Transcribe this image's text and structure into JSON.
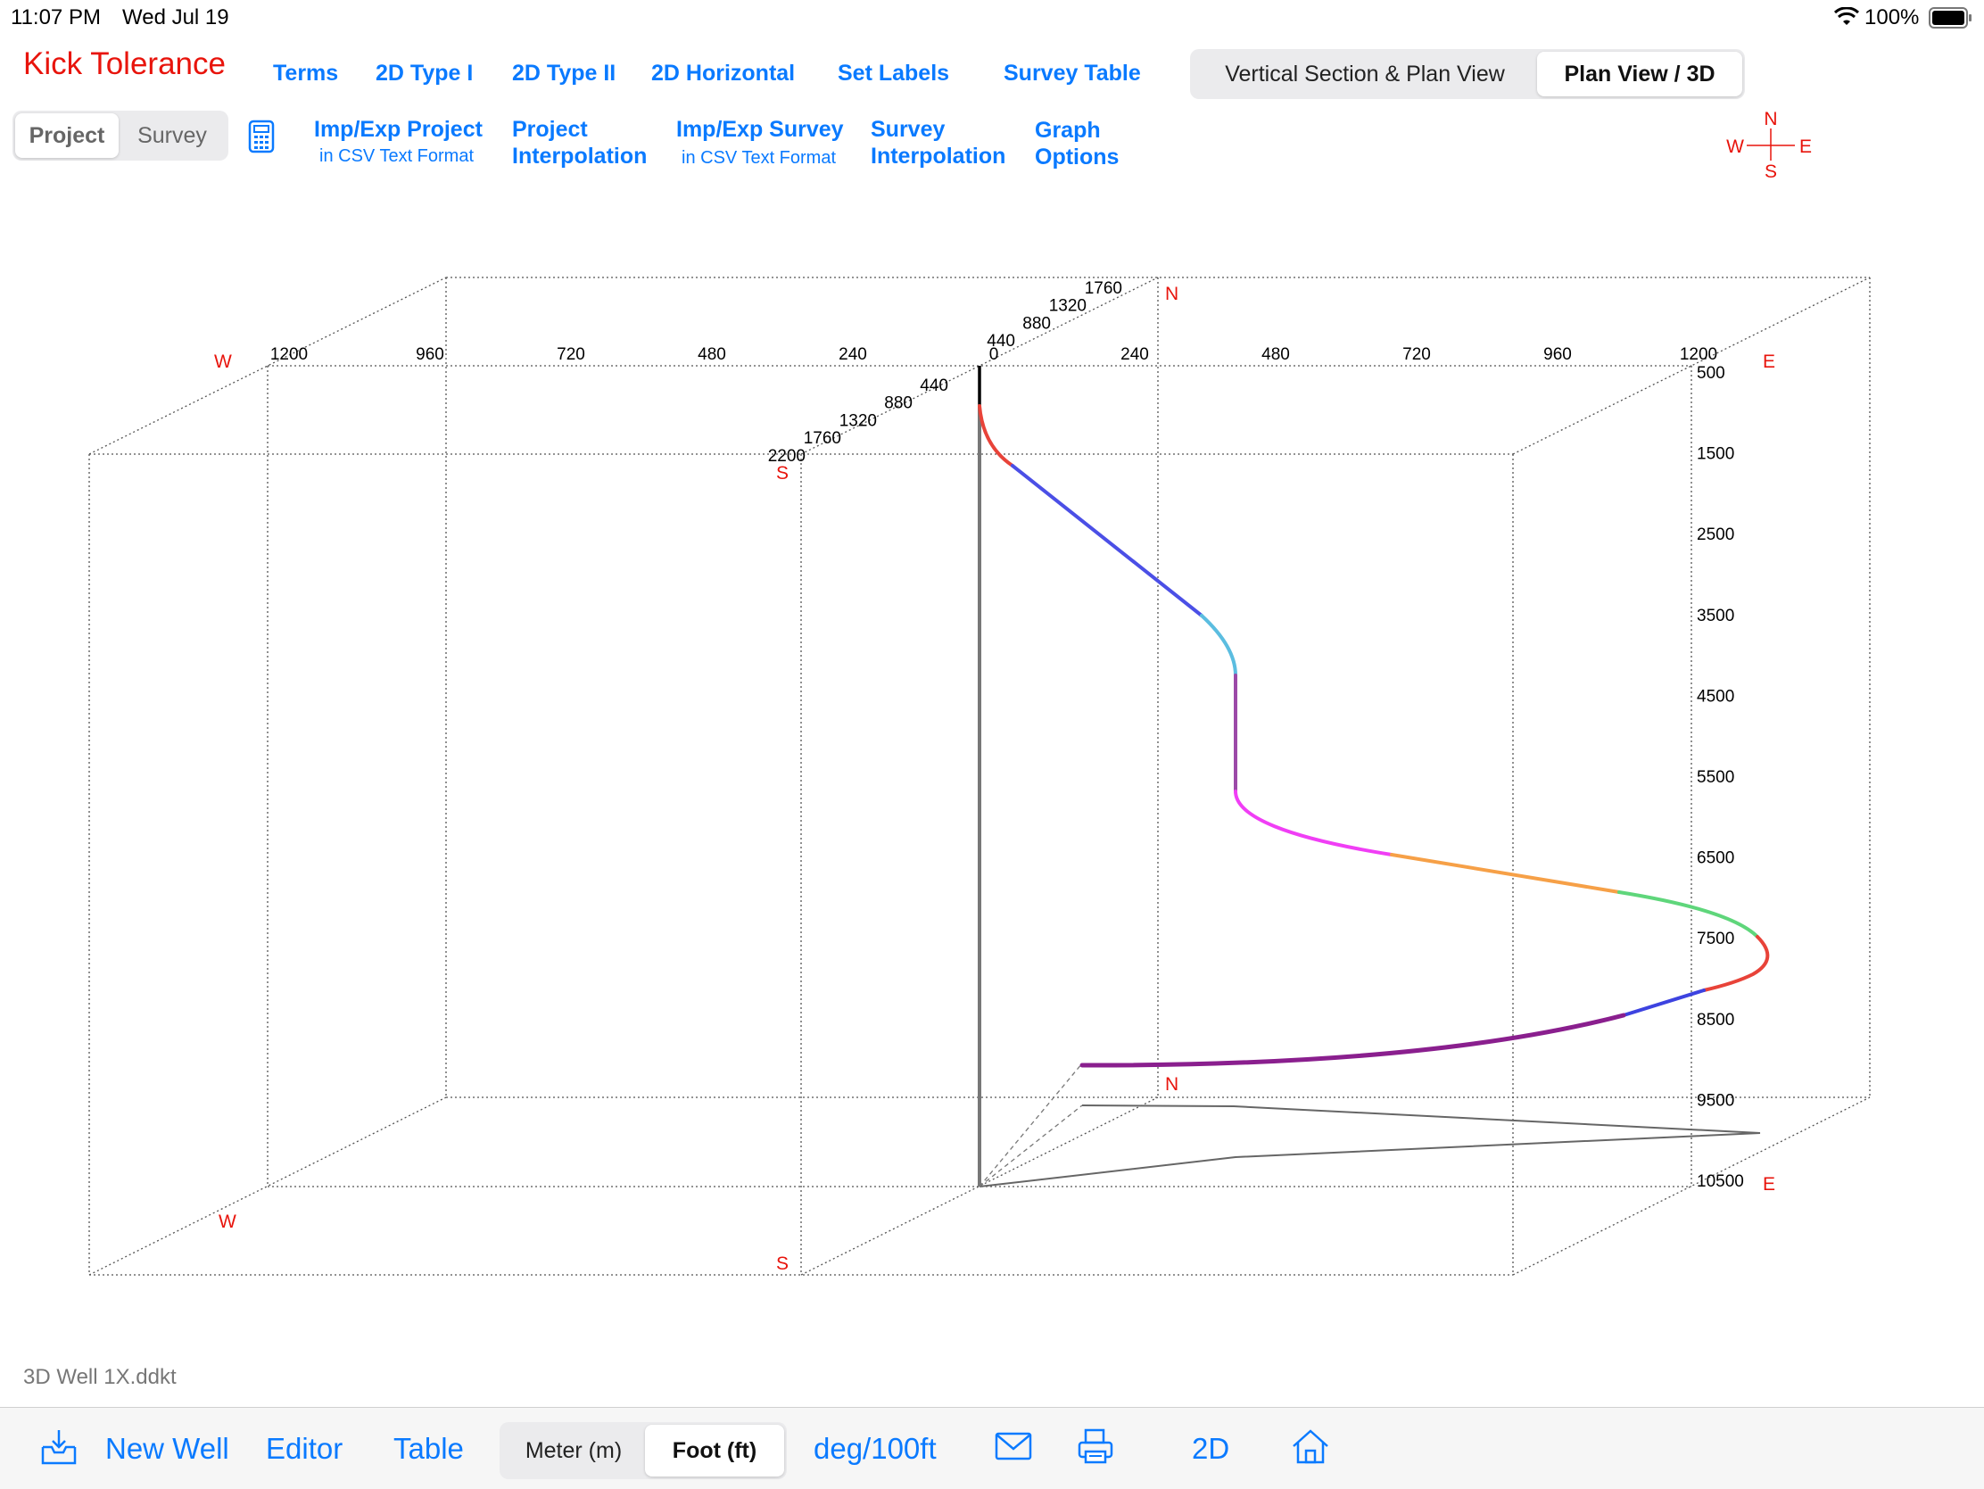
{
  "status_bar": {
    "time": "11:07 PM",
    "date": "Wed Jul 19",
    "battery": "100%"
  },
  "app_title": "Kick Tolerance",
  "nav": {
    "terms": "Terms",
    "type1": "2D Type I",
    "type2": "2D Type II",
    "horizontal": "2D Horizontal",
    "set_labels": "Set Labels",
    "survey_table": "Survey Table"
  },
  "view_tabs": {
    "options": [
      "Vertical Section & Plan View",
      "Plan View / 3D"
    ],
    "selected": "Plan View / 3D"
  },
  "mode_tabs": {
    "options": [
      "Project",
      "Survey"
    ],
    "selected": "Project"
  },
  "actions": {
    "imp_project_1": "Imp/Exp Project",
    "imp_project_2": "in CSV Text Format",
    "proj_interp_1": "Project",
    "proj_interp_2": "Interpolation",
    "imp_survey_1": "Imp/Exp Survey",
    "imp_survey_2": "in CSV Text Format",
    "survey_interp_1": "Survey",
    "survey_interp_2": "Interpolation",
    "graph_1": "Graph",
    "graph_2": "Options"
  },
  "compass": {
    "n": "N",
    "s": "S",
    "w": "W",
    "e": "E"
  },
  "colors": {
    "accent": "#0a7aff",
    "title": "#e8140c",
    "direction": "#e8140c"
  },
  "chart_data": {
    "type": "line",
    "ew_ticks": [
      "1200",
      "960",
      "720",
      "480",
      "240",
      "0",
      "240",
      "480",
      "720",
      "960",
      "1200"
    ],
    "ns_ticks_north": [
      "440",
      "880",
      "1320",
      "1760"
    ],
    "ns_ticks_south": [
      "440",
      "880",
      "1320",
      "1760",
      "2200"
    ],
    "depth_ticks": [
      "500",
      "1500",
      "2500",
      "3500",
      "4500",
      "5500",
      "6500",
      "7500",
      "8500",
      "9500",
      "10500"
    ],
    "direction_labels": {
      "w": "W",
      "e": "E",
      "n": "N",
      "s": "S"
    }
  },
  "file_name": "3D Well 1X.ddkt",
  "toolbar": {
    "new_well": "New Well",
    "editor": "Editor",
    "table": "Table",
    "units": {
      "options": [
        "Meter (m)",
        "Foot (ft)"
      ],
      "selected": "Foot (ft)"
    },
    "dogleg": "deg/100ft",
    "mode_2d": "2D"
  }
}
